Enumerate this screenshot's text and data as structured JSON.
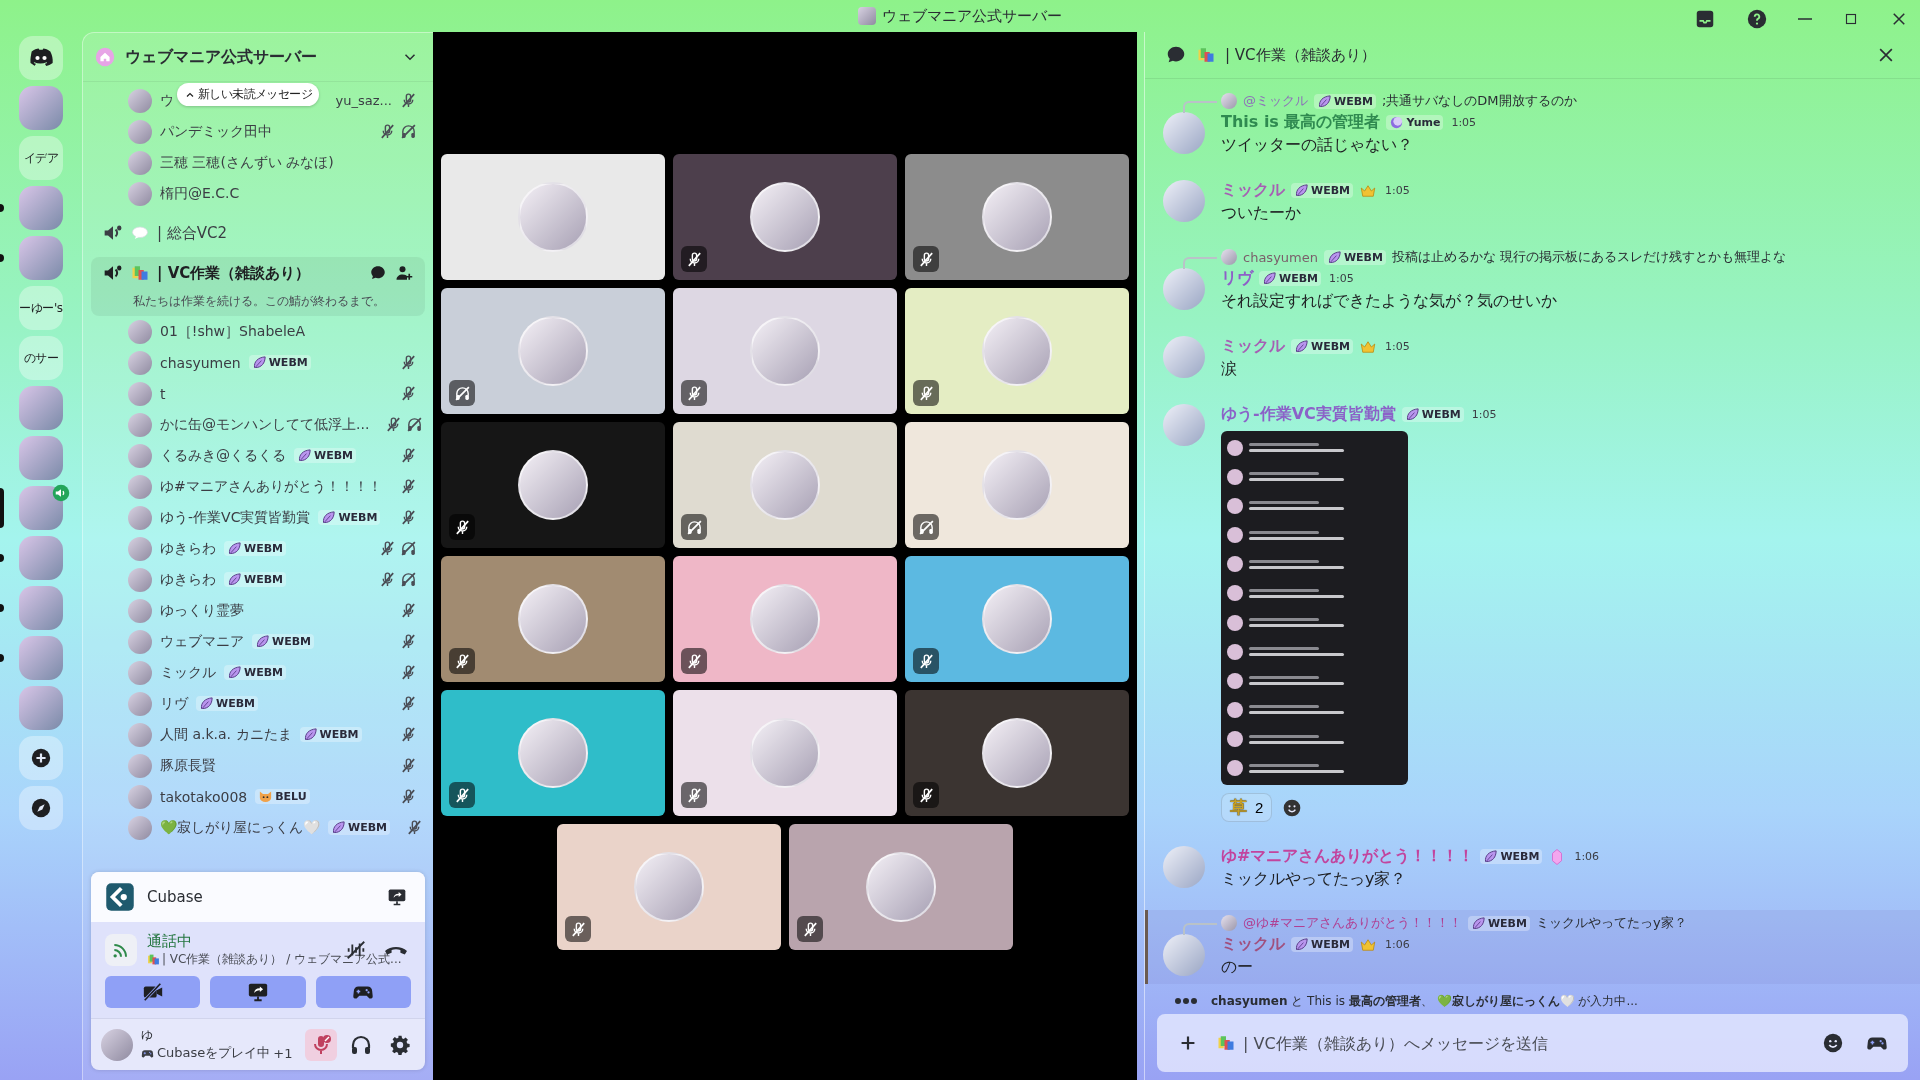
{
  "title_bar": {
    "title": "ウェブマニア公式サーバー"
  },
  "servers": [
    {
      "kind": "home",
      "unread": false,
      "selected": false,
      "in_voice": false
    },
    {
      "kind": "image",
      "unread": false,
      "selected": false,
      "in_voice": false
    },
    {
      "kind": "text",
      "label": "イデア",
      "unread": false,
      "selected": false,
      "in_voice": false
    },
    {
      "kind": "image",
      "unread": true,
      "selected": false,
      "in_voice": false
    },
    {
      "kind": "image",
      "unread": true,
      "selected": false,
      "in_voice": false
    },
    {
      "kind": "text",
      "label": "ーゆー's",
      "unread": false,
      "selected": false,
      "in_voice": false
    },
    {
      "kind": "text",
      "label": "のサー",
      "unread": false,
      "selected": false,
      "in_voice": false
    },
    {
      "kind": "image",
      "unread": false,
      "selected": false,
      "in_voice": false
    },
    {
      "kind": "image",
      "unread": false,
      "selected": false,
      "in_voice": false
    },
    {
      "kind": "image",
      "unread": false,
      "selected": true,
      "in_voice": true
    },
    {
      "kind": "image",
      "unread": true,
      "selected": false,
      "in_voice": false
    },
    {
      "kind": "image",
      "unread": true,
      "selected": false,
      "in_voice": false
    },
    {
      "kind": "image",
      "unread": true,
      "selected": false,
      "in_voice": false
    },
    {
      "kind": "image",
      "unread": false,
      "selected": false,
      "in_voice": false
    },
    {
      "kind": "add",
      "unread": false,
      "selected": false,
      "in_voice": false
    },
    {
      "kind": "explore",
      "unread": false,
      "selected": false,
      "in_voice": false
    }
  ],
  "server_header": {
    "name": "ウェブマニア公式サーバー"
  },
  "unread_toast": {
    "label": "新しい未読メッセージ"
  },
  "members_above": [
    {
      "name": "ウ",
      "name_tail": "yu_saz...",
      "muted": true,
      "deafened": false
    },
    {
      "name": "パンデミック田中",
      "muted": true,
      "deafened": true
    },
    {
      "name": "三穂 三穂(さんずい みなほ)",
      "muted": false,
      "deafened": false
    },
    {
      "name": "楕円@E.C.C",
      "muted": false,
      "deafened": false
    }
  ],
  "voice_channels": [
    {
      "kind": "speech",
      "name": "| 総合VC2",
      "selected": false
    },
    {
      "kind": "books",
      "name": "| VC作業（雑談あり）",
      "selected": true,
      "status": "私たちは作業を続ける。この鯖が終わるまで。",
      "members": [
        {
          "name": "01［!shw］ShabeleA",
          "muted": false,
          "deafened": false
        },
        {
          "name": "chasyumen",
          "tag": {
            "kind": "leaf",
            "text": "WEBM"
          },
          "muted": true,
          "deafened": false
        },
        {
          "name": "t",
          "muted": true,
          "deafened": false
        },
        {
          "name": "かに缶@モンハンしてて低浮上...",
          "muted": true,
          "deafened": true
        },
        {
          "name": "くるみき@くるくる",
          "tag": {
            "kind": "leaf",
            "text": "WEBM"
          },
          "muted": true,
          "deafened": false
        },
        {
          "name": "ゆ#マニアさんありがとう！！！！",
          "muted": true,
          "deafened": false
        },
        {
          "name": "ゆう-作業VC実質皆勤賞",
          "tag": {
            "kind": "leaf",
            "text": "WEBM"
          },
          "muted": true,
          "deafened": false
        },
        {
          "name": "ゆきらわ",
          "tag": {
            "kind": "leaf",
            "text": "WEBM"
          },
          "muted": true,
          "deafened": true
        },
        {
          "name": "ゆきらわ",
          "tag": {
            "kind": "leaf",
            "text": "WEBM"
          },
          "muted": true,
          "deafened": true
        },
        {
          "name": "ゆっくり霊夢",
          "muted": true,
          "deafened": false
        },
        {
          "name": "ウェブマニア",
          "tag": {
            "kind": "leaf",
            "text": "WEBM"
          },
          "muted": true,
          "deafened": false
        },
        {
          "name": "ミックル",
          "tag": {
            "kind": "leaf",
            "text": "WEBM"
          },
          "muted": true,
          "deafened": false
        },
        {
          "name": "リヴ",
          "tag": {
            "kind": "leaf",
            "text": "WEBM"
          },
          "muted": true,
          "deafened": false
        },
        {
          "name": "人間 a.k.a. カニたま",
          "tag": {
            "kind": "leaf",
            "text": "WEBM"
          },
          "muted": true,
          "deafened": false
        },
        {
          "name": "豚原長賢",
          "muted": true,
          "deafened": false
        },
        {
          "name": "takotako008",
          "tag": {
            "kind": "cat",
            "text": "BELU"
          },
          "muted": true,
          "deafened": false
        },
        {
          "name": "💚寂しがり屋にっくん🤍",
          "tag": {
            "kind": "leaf",
            "text": "WEBM"
          },
          "muted": true,
          "deafened": false
        }
      ]
    }
  ],
  "video_tiles": [
    {
      "color": "#e9e9e9",
      "muted": false,
      "deafened": false
    },
    {
      "color": "#4d3f4c",
      "muted": true,
      "deafened": false
    },
    {
      "color": "#8c8c8c",
      "muted": true,
      "deafened": false
    },
    {
      "color": "#c9cfd9",
      "muted": false,
      "deafened": true
    },
    {
      "color": "#ddd7e3",
      "muted": true,
      "deafened": false
    },
    {
      "color": "#e4edc3",
      "muted": true,
      "deafened": false
    },
    {
      "color": "#161616",
      "muted": true,
      "deafened": false
    },
    {
      "color": "#dfdbd0",
      "muted": false,
      "deafened": true
    },
    {
      "color": "#efe7dc",
      "muted": false,
      "deafened": true
    },
    {
      "color": "#a18b71",
      "muted": true,
      "deafened": false
    },
    {
      "color": "#efb7c7",
      "muted": true,
      "deafened": false
    },
    {
      "color": "#5cb9e1",
      "muted": true,
      "deafened": false
    },
    {
      "color": "#2fbdc9",
      "muted": true,
      "deafened": false
    },
    {
      "color": "#ece0ea",
      "muted": true,
      "deafened": false
    },
    {
      "color": "#3b3431",
      "muted": true,
      "deafened": false
    },
    {
      "color": "#ead3c9",
      "muted": true,
      "deafened": false
    },
    {
      "color": "#b9a4ad",
      "muted": true,
      "deafened": false
    }
  ],
  "activity": {
    "name": "Cubase"
  },
  "voice_status": {
    "label": "通話中",
    "channel": "| VC作業（雑談あり） / ウェブマニア公式..."
  },
  "user": {
    "name": "ゆ",
    "activity": "Cubaseをプレイ中",
    "extra": "+1",
    "mic_muted": true
  },
  "chat": {
    "title": "| VC作業（雑談あり）",
    "messages": [
      {
        "reply": {
          "author": "@ミックル",
          "color": "#8d72b8",
          "tag": {
            "kind": "leaf",
            "text": "WEBM"
          },
          "text": ";共通サバなしのDM開放するのか"
        },
        "author": "This is **最高の管理者**",
        "color": "#2f8a50",
        "tag": {
          "kind": "moon",
          "text": "Yume"
        },
        "time": "1:05",
        "text": "ツイッターの話じゃない？",
        "highlighted": false
      },
      {
        "author": "ミックル",
        "color": "#a65fb4",
        "tag": {
          "kind": "leaf",
          "text": "WEBM"
        },
        "badge": {
          "kind": "crown"
        },
        "time": "1:05",
        "text": "ついたーか",
        "highlighted": false
      },
      {
        "reply": {
          "author": "chasyumen",
          "color": "#7a5f6a",
          "tag": {
            "kind": "leaf",
            "text": "WEBM"
          },
          "text": "投稿は止めるかな 現行の掲示板にあるスレだけ残すとかも無理よな"
        },
        "author": "リヴ",
        "color": "#8e5ec8",
        "tag": {
          "kind": "leaf",
          "text": "WEBM"
        },
        "time": "1:05",
        "text": "それ設定すればできたような気が？気のせいか",
        "highlighted": false
      },
      {
        "author": "ミックル",
        "color": "#a65fb4",
        "tag": {
          "kind": "leaf",
          "text": "WEBM"
        },
        "badge": {
          "kind": "crown"
        },
        "time": "1:05",
        "text": "涙",
        "highlighted": false
      },
      {
        "author": "ゆう-作業VC実質皆勤賞",
        "color": "#8b62c8",
        "tag": {
          "kind": "leaf",
          "text": "WEBM"
        },
        "time": "1:05",
        "attachment": {
          "kind": "image"
        },
        "reactions": [
          {
            "emoji": "草",
            "count": "2"
          }
        ],
        "highlighted": false
      },
      {
        "author": "ゆ#マニアさんありがとう！！！！",
        "color": "#c2449e",
        "tag": {
          "kind": "leaf",
          "text": "WEBM"
        },
        "badge": {
          "kind": "gem"
        },
        "time": "1:06",
        "text": "ミックルやってたっy家？",
        "highlighted": false
      },
      {
        "reply": {
          "author": "@ゆ#マニアさんありがとう！！！！",
          "color": "#b03f92",
          "tag": {
            "kind": "leaf",
            "text": "WEBM"
          },
          "text": "ミックルやってたっy家？"
        },
        "author": "ミックル",
        "color": "#a0507e",
        "tag": {
          "kind": "leaf",
          "text": "WEBM"
        },
        "badge": {
          "kind": "crown"
        },
        "time": "1:06",
        "text": "のー",
        "highlighted": true
      }
    ],
    "typing": "**chasyumen** と This is **最高の管理者**、 **💚寂しがり屋にっくん🤍** が入力中...",
    "input_placeholder": "| VC作業（雑談あり）へメッセージを送信"
  }
}
